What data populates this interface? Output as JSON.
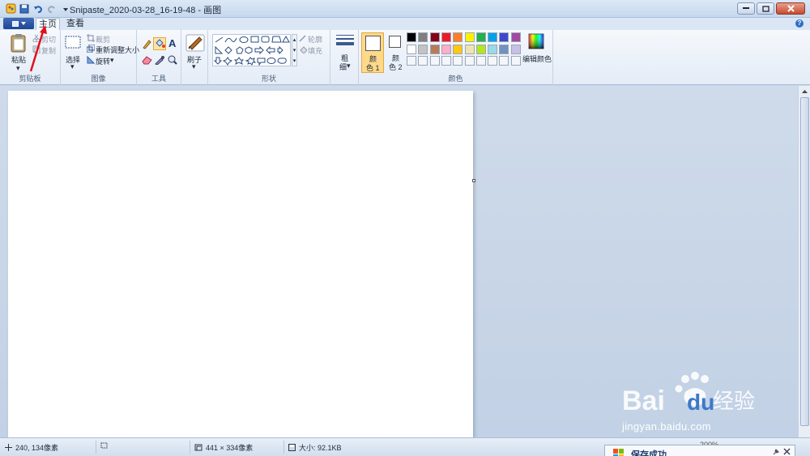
{
  "window": {
    "title": "Snipaste_2020-03-28_16-19-48 - 画图"
  },
  "tabs": [
    {
      "label": "主页"
    },
    {
      "label": "查看"
    }
  ],
  "ribbon": {
    "clipboard": {
      "paste": "粘贴",
      "cut": "剪切",
      "copy": "复制",
      "group": "剪贴板"
    },
    "image": {
      "select": "选择",
      "crop": "裁剪",
      "resize": "重新调整大小",
      "rotate": "旋转",
      "group": "图像"
    },
    "tools": {
      "text_glyph": "A",
      "group": "工具"
    },
    "brushes": {
      "label": "刷子"
    },
    "shapes": {
      "outline": "轮廓",
      "fill": "填充",
      "group": "形状"
    },
    "size": {
      "label_line1": "粗",
      "label_line2": "细"
    },
    "colors": {
      "color1_line1": "颜",
      "color1_line2": "色 1",
      "color2_line1": "颜",
      "color2_line2": "色 2",
      "edit": "编辑颜色",
      "group": "颜色",
      "palette_row1": [
        "#000000",
        "#7f7f7f",
        "#880015",
        "#ed1c24",
        "#ff7f27",
        "#fff200",
        "#22b14c",
        "#00a2e8",
        "#3f48cc",
        "#a349a4"
      ],
      "palette_row2": [
        "#ffffff",
        "#c3c3c3",
        "#b97a57",
        "#ffaec9",
        "#ffc90e",
        "#efe4b0",
        "#b5e61d",
        "#99d9ea",
        "#7092be",
        "#c8bfe7"
      ]
    }
  },
  "status": {
    "cursor_pos": "240, 134像素",
    "image_size": "441 × 334像素",
    "file_size": "大小: 92.1KB",
    "zoom": "200%"
  },
  "toast": {
    "title": "保存成功"
  },
  "watermark": {
    "brand_latin": "Bai",
    "brand_latin2": "du",
    "brand_cn": "经验",
    "url": "jingyan.baidu.com"
  },
  "colors": {
    "accent": "#2e6fc6",
    "arrow": "#e0101a"
  }
}
